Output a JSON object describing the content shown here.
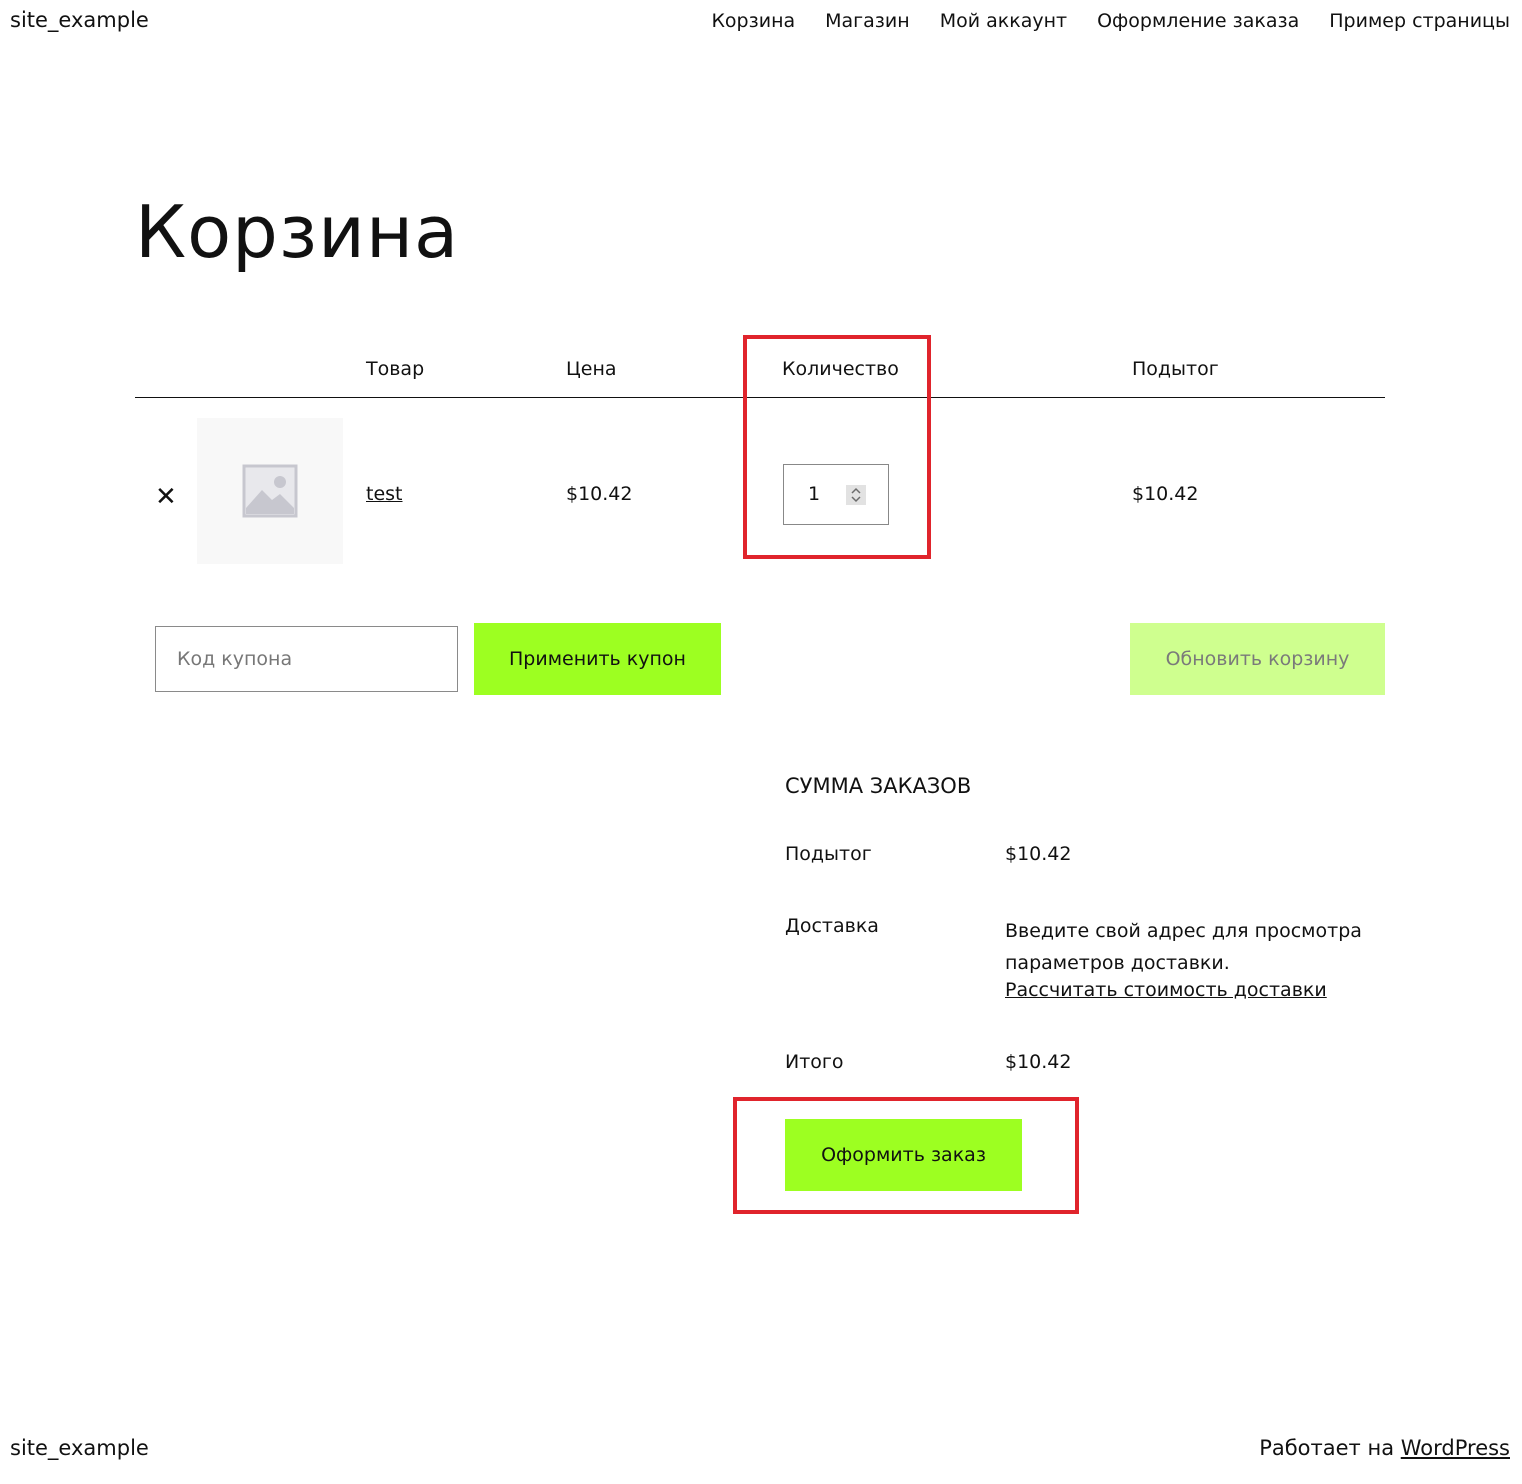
{
  "header": {
    "site_title": "site_example",
    "nav": [
      "Корзина",
      "Магазин",
      "Мой аккаунт",
      "Оформление заказа",
      "Пример страницы"
    ]
  },
  "page_title": "Корзина",
  "cart_table": {
    "headers": {
      "product": "Товар",
      "price": "Цена",
      "quantity": "Количество",
      "subtotal": "Подытог"
    },
    "rows": [
      {
        "remove_icon": "close-icon",
        "image_icon": "placeholder-image-icon",
        "product": "test",
        "price": "$10.42",
        "quantity": "1",
        "subtotal": "$10.42"
      }
    ]
  },
  "coupon": {
    "placeholder": "Код купона",
    "apply_label": "Применить купон"
  },
  "update_label": "Обновить корзину",
  "totals": {
    "title": "СУММА ЗАКАЗОВ",
    "subtotal_label": "Подытог",
    "subtotal_value": "$10.42",
    "shipping_label": "Доставка",
    "shipping_note": "Введите свой адрес для просмотра параметров доставки.",
    "shipping_link": "Рассчитать стоимость доставки",
    "total_label": "Итого",
    "total_value": "$10.42",
    "checkout_label": "Оформить заказ"
  },
  "footer": {
    "site_title": "site_example",
    "credit_prefix": "Работает на",
    "credit_link": "WordPress"
  },
  "colors": {
    "accent": "#9dff21",
    "accent_disabled": "#cfff8f",
    "highlight": "#e0242c"
  }
}
